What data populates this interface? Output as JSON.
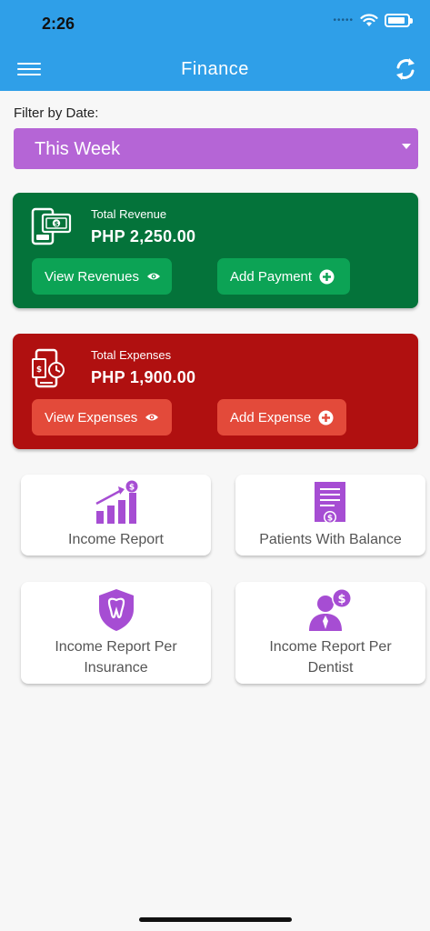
{
  "status_bar": {
    "time": "2:26",
    "signal_dots": "•••••"
  },
  "header": {
    "title": "Finance",
    "menu_icon": "hamburger-icon",
    "refresh_icon": "refresh-icon"
  },
  "filter": {
    "label": "Filter by Date:",
    "selected": "This Week"
  },
  "revenue": {
    "label": "Total Revenue",
    "amount": "PHP 2,250.00",
    "view_button": "View Revenues",
    "add_button": "Add Payment"
  },
  "expenses": {
    "label": "Total Expenses",
    "amount": "PHP 1,900.00",
    "view_button": "View Expenses",
    "add_button": "Add Expense"
  },
  "tiles": [
    {
      "label": "Income Report",
      "icon": "income-report-chart-icon"
    },
    {
      "label": "Patients With Balance",
      "icon": "invoice-dollar-icon"
    },
    {
      "label_line1": "Income Report Per",
      "label_line2": "Insurance",
      "icon": "tooth-shield-icon"
    },
    {
      "label_line1": "Income Report Per",
      "label_line2": "Dentist",
      "icon": "dentist-dollar-icon"
    }
  ],
  "colors": {
    "header_blue": "#2f9fe8",
    "filter_purple": "#b565d6",
    "revenue_green": "#04733a",
    "revenue_button_green": "#0ca355",
    "expense_red": "#b01010",
    "expense_button_red": "#e34a3a",
    "tile_icon_purple": "#a64dd3"
  }
}
